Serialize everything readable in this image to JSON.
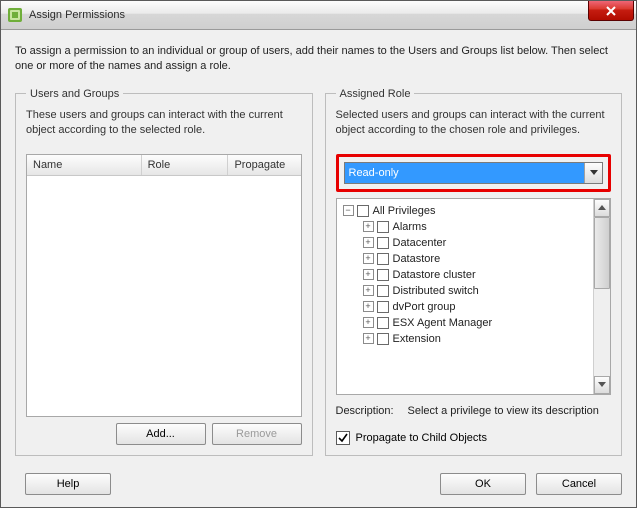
{
  "window": {
    "title": "Assign Permissions"
  },
  "intro": "To assign a permission to an individual or group of users, add their names to the Users and Groups list below. Then select one or more of the names and assign a role.",
  "users_panel": {
    "legend": "Users and Groups",
    "desc": "These users and groups can interact with the current object according to the selected role.",
    "columns": {
      "name": "Name",
      "role": "Role",
      "propagate": "Propagate"
    },
    "add_label": "Add...",
    "remove_label": "Remove"
  },
  "role_panel": {
    "legend": "Assigned Role",
    "desc": "Selected users and groups can interact with the current object according to the chosen role and privileges.",
    "selected_role": "Read-only",
    "privileges_root": "All Privileges",
    "privileges": [
      "Alarms",
      "Datacenter",
      "Datastore",
      "Datastore cluster",
      "Distributed switch",
      "dvPort group",
      "ESX Agent Manager",
      "Extension"
    ],
    "description_label": "Description:",
    "description_value": "Select a privilege to view its description",
    "propagate_label": "Propagate to Child Objects"
  },
  "footer": {
    "help": "Help",
    "ok": "OK",
    "cancel": "Cancel"
  }
}
